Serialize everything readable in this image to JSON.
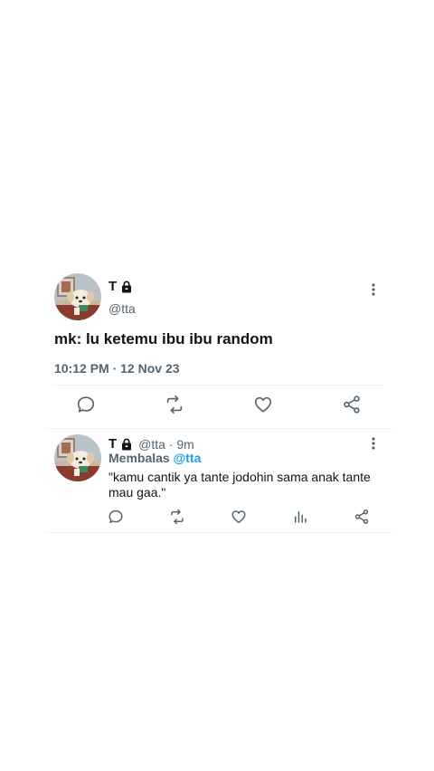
{
  "main_tweet": {
    "display_name": "T",
    "handle": "@tta",
    "text": "mk: lu ketemu ibu ibu random",
    "timestamp": "10:12 PM · 12 Nov 23"
  },
  "reply_tweet": {
    "display_name": "T",
    "meta": "@tta · 9m",
    "replying_label": "Membalas ",
    "replying_mention": "@tta",
    "text": "\"kamu cantik ya tante jodohin sama anak tante mau gaa.\""
  },
  "colors": {
    "primary_text": "#0f1419",
    "secondary_text": "#536471",
    "accent": "#1d9bf0",
    "divider": "#eff3f4"
  },
  "icons": {
    "lock": "lock-icon",
    "more": "more-vertical-icon",
    "reply": "comment-icon",
    "retweet": "retweet-icon",
    "like": "heart-icon",
    "analytics": "bar-chart-icon",
    "share": "share-icon"
  }
}
